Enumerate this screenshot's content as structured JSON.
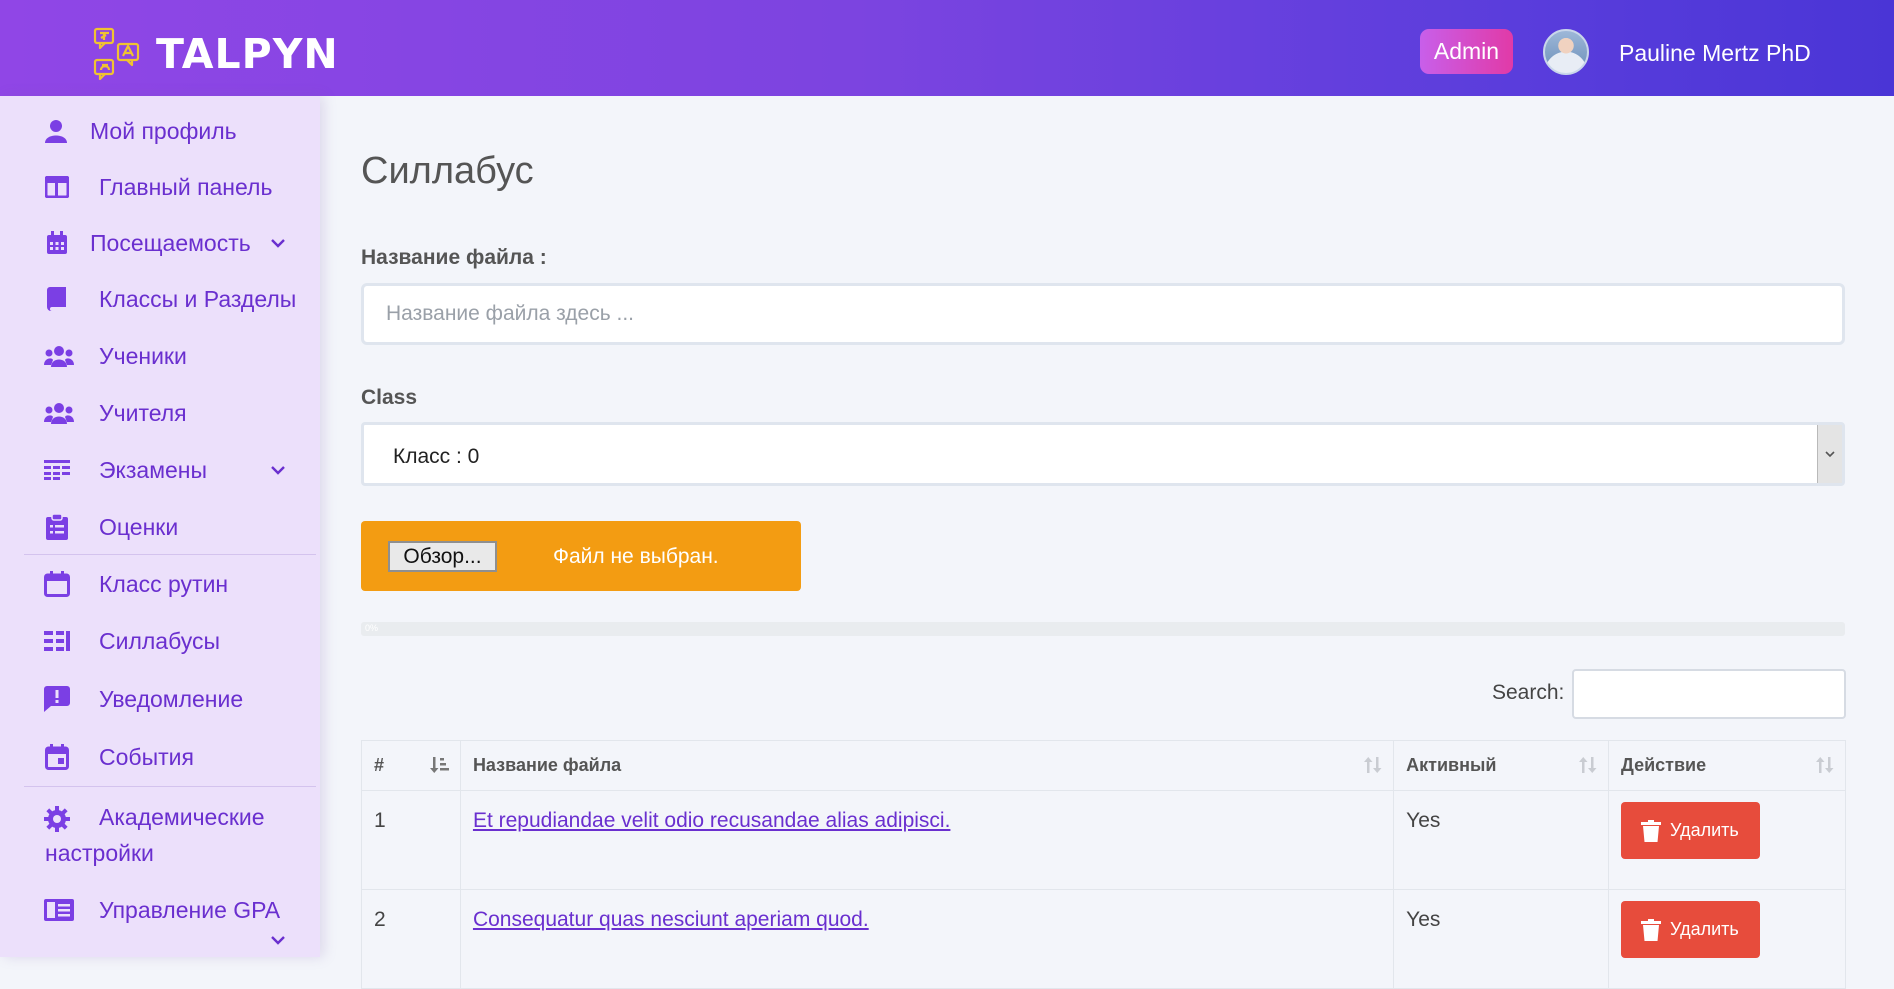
{
  "header": {
    "brand": "TALPYN",
    "role_badge": "Admin",
    "user_name": "Pauline Mertz PhD"
  },
  "sidebar": {
    "items": [
      {
        "label": "Мой профиль",
        "icon": "user-icon"
      },
      {
        "label": "Главный панель",
        "icon": "dashboard-icon"
      },
      {
        "label": "Посещаемость",
        "icon": "calendar-icon",
        "expandable": true
      },
      {
        "label": "Классы и Разделы",
        "icon": "book-icon"
      },
      {
        "label": "Ученики",
        "icon": "users-icon"
      },
      {
        "label": "Учителя",
        "icon": "users-icon"
      },
      {
        "label": "Экзамены",
        "icon": "table-icon",
        "expandable": true
      },
      {
        "label": "Оценки",
        "icon": "clipboard-icon"
      },
      {
        "label": "Класс рутин",
        "icon": "calendar-blank-icon"
      },
      {
        "label": "Силлабусы",
        "icon": "list-icon"
      },
      {
        "label": "Уведомление",
        "icon": "alert-message-icon"
      },
      {
        "label": "События",
        "icon": "event-icon"
      },
      {
        "label": "Академические настройки",
        "label_line1": "Академические",
        "label_line2": "настройки",
        "icon": "gear-icon"
      },
      {
        "label": "Управление GPA",
        "icon": "id-card-icon",
        "expandable": true
      }
    ]
  },
  "main": {
    "title": "Силлабус",
    "file_name_label": "Название файла :",
    "file_name_placeholder": "Название файла здесь ...",
    "file_name_value": "",
    "class_label": "Class",
    "class_selected": "Класс : 0",
    "file_button": "Обзор...",
    "file_status": "Файл не выбран.",
    "progress_text": "0%",
    "progress_value": 0,
    "search_label": "Search:",
    "search_value": ""
  },
  "table": {
    "columns": [
      "#",
      "Название файла",
      "Активный",
      "Действие"
    ],
    "rows": [
      {
        "num": "1",
        "file": "Et repudiandae velit odio recusandae alias adipisci.",
        "active": "Yes",
        "action": "Удалить"
      },
      {
        "num": "2",
        "file": "Consequatur quas nesciunt aperiam quod.",
        "active": "Yes",
        "action": "Удалить"
      }
    ]
  },
  "colors": {
    "header_gradient_start": "#9046e6",
    "header_gradient_end": "#4a35d6",
    "sidebar_bg": "#ece0fb",
    "accent": "#6a2fcf",
    "file_bar": "#f39c12",
    "delete_button": "#e74c3c"
  }
}
